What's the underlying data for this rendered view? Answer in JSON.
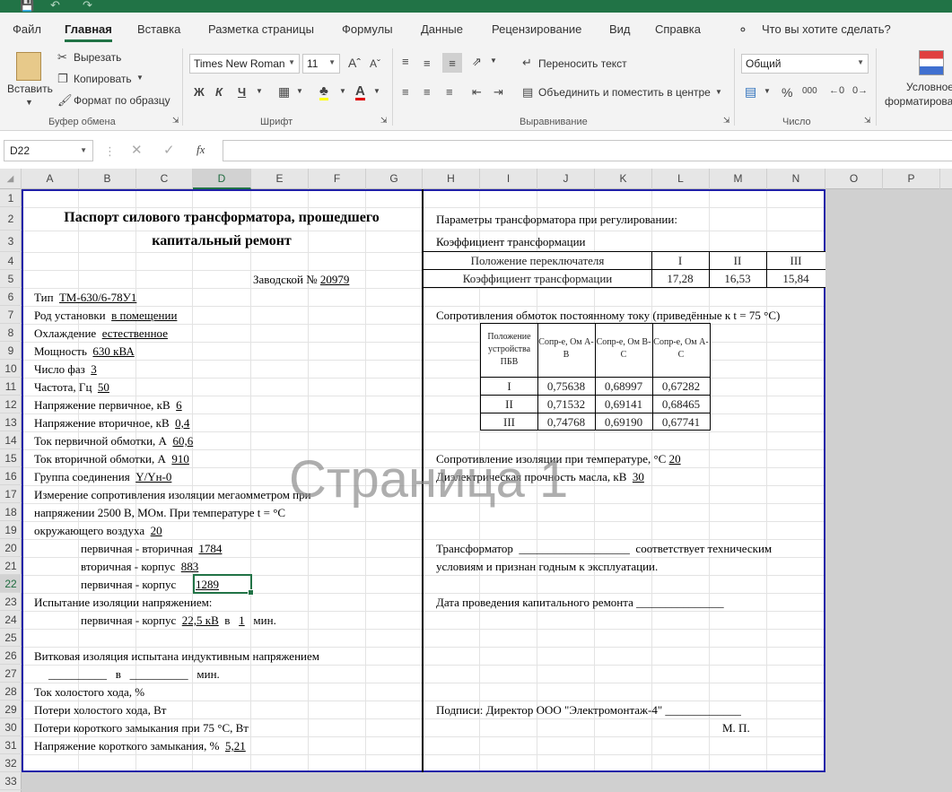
{
  "menu": {
    "tabs": [
      "Файл",
      "Главная",
      "Вставка",
      "Разметка страницы",
      "Формулы",
      "Данные",
      "Рецензирование",
      "Вид",
      "Справка"
    ],
    "tell_me": "Что вы хотите сделать?"
  },
  "ribbon": {
    "clipboard": {
      "paste": "Вставить",
      "cut": "Вырезать",
      "copy": "Копировать",
      "format_painter": "Формат по образцу",
      "group": "Буфер обмена"
    },
    "font": {
      "name": "Times New Roman",
      "size": "11",
      "bold": "Ж",
      "italic": "К",
      "underline": "Ч",
      "group": "Шрифт"
    },
    "alignment": {
      "wrap": "Переносить текст",
      "merge": "Объединить и поместить в центре",
      "group": "Выравнивание"
    },
    "number": {
      "format": "Общий",
      "percent": "%",
      "thousands": "000",
      "group": "Число"
    },
    "styles": {
      "conditional_l1": "Условное",
      "conditional_l2": "форматирова"
    }
  },
  "formula_bar": {
    "name_box": "D22",
    "fx": "fx",
    "value": ""
  },
  "columns": [
    "A",
    "B",
    "C",
    "D",
    "E",
    "F",
    "G",
    "H",
    "I",
    "J",
    "K",
    "L",
    "M",
    "N",
    "O",
    "P"
  ],
  "rows": [
    "1",
    "2",
    "3",
    "4",
    "5",
    "6",
    "7",
    "8",
    "9",
    "10",
    "11",
    "12",
    "13",
    "14",
    "15",
    "16",
    "17",
    "18",
    "19",
    "20",
    "21",
    "22",
    "23",
    "24",
    "25",
    "26",
    "27",
    "28",
    "29",
    "30",
    "31",
    "32",
    "33"
  ],
  "watermark": "Страница 1",
  "left": {
    "title1": "Паспорт силового трансформатора, прошедшего",
    "title2": "капитальный ремонт",
    "serial_label": "Заводской №",
    "serial": "20979",
    "type_label": "Тип",
    "type": "ТМ-630/6-78У1",
    "install_label": "Род установки",
    "install": "в помещении",
    "cooling_label": "Охлаждение",
    "cooling": "естественное",
    "power_label": "Мощность",
    "power": "630 кВА",
    "phases_label": "Число фаз",
    "phases": "3",
    "freq_label": "Частота, Гц",
    "freq": "50",
    "v1_label": "Напряжение первичное, кВ",
    "v1": "6",
    "v2_label": "Напряжение вторичное, кВ",
    "v2": "0,4",
    "i1_label": "Ток первичной обмотки, А",
    "i1": "60,6",
    "i2_label": "Ток вторичной обмотки, А",
    "i2": "910",
    "group_label": "Группа соединения",
    "group": "Y/Yн-0",
    "ins1": "Измерение сопротивления изоляции мегаомметром при",
    "ins2": "напряжении 2500 В, МОм. При температуре t = °С",
    "ins3_label": "окружающего воздуха",
    "ins3": "20",
    "pv_label": "первичная - вторичная",
    "pv": "1784",
    "vk_label": "вторичная - корпус",
    "vk": "883",
    "pk_label": "первичная - корпус",
    "pk": "1289",
    "test_label": "Испытание изоляции напряжением:",
    "test_pk_label": "первичная - корпус",
    "test_kv": "22,5 кВ",
    "test_in": "в",
    "test_min_val": "1",
    "test_min": "мин.",
    "turn1": "Витковая изоляция испытана индуктивным напряжением",
    "turn_blank1": "__________",
    "turn_in": "в",
    "turn_blank2": "__________",
    "turn_min": "мин.",
    "noload_i": "Ток холостого хода, %",
    "noload_p": "Потери холостого хода, Вт",
    "sc_p": "Потери короткого замыкания при 75 °С, Вт",
    "sc_v_label": "Напряжение короткого замыкания, %",
    "sc_v": "5,21"
  },
  "right": {
    "reg_title": "Параметры трансформатора при регулировании:",
    "ratio_title": "Коэффициент трансформации",
    "ratio_table": {
      "h": [
        "Положение переключателя",
        "I",
        "II",
        "III"
      ],
      "r": [
        "Коэффициент трансформации",
        "17,28",
        "16,53",
        "15,84"
      ]
    },
    "res_title": "Сопротивления обмоток постоянному току (приведённые к t = 75 °С)",
    "res_table": {
      "h": [
        "Положение устройства ПБВ",
        "Сопр-е, Ом А-В",
        "Сопр-е, Ом В-С",
        "Сопр-е, Ом А-С"
      ],
      "rows": [
        [
          "I",
          "0,75638",
          "0,68997",
          "0,67282"
        ],
        [
          "II",
          "0,71532",
          "0,69141",
          "0,68465"
        ],
        [
          "III",
          "0,74768",
          "0,69190",
          "0,67741"
        ]
      ]
    },
    "ins_temp_label": "Сопротивление изоляции при температуре, °С",
    "ins_temp": "20",
    "oil_label": "Диэлектрическая прочность масла, кВ",
    "oil": "30",
    "tr1": "Трансформатор",
    "tr_blank": "___________________",
    "tr2": "соответствует техническим",
    "tr3": "условиям и признан годным к эксплуатации.",
    "date": "Дата проведения капитального ремонта _______________",
    "sign": "Подписи: Директор ООО \"Электромонтаж-4\"  _____________",
    "mp": "М. П."
  }
}
